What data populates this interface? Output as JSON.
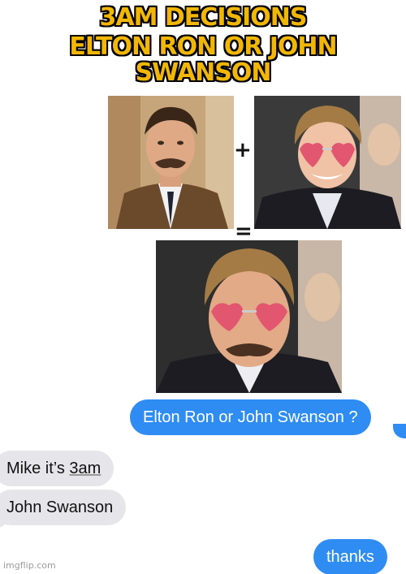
{
  "meme": {
    "caption_line1": "3AM DECISIONS",
    "caption_line2": "ELTON RON OR JOHN SWANSON"
  },
  "composite": {
    "plus_symbol": "+",
    "equals_symbol": "="
  },
  "messages": [
    {
      "direction": "outgoing",
      "text": "Elton Ron or John Swanson ?"
    },
    {
      "direction": "incoming",
      "text_before": "Mike it’s ",
      "text_underlined": "3am"
    },
    {
      "direction": "incoming",
      "text": "John Swanson"
    },
    {
      "direction": "outgoing",
      "text": "thanks"
    }
  ],
  "watermark": "imgflip.com",
  "colors": {
    "caption_fill": "#f2b705",
    "outgoing_bubble": "#2f8cf3",
    "incoming_bubble": "#e6e6ea"
  }
}
